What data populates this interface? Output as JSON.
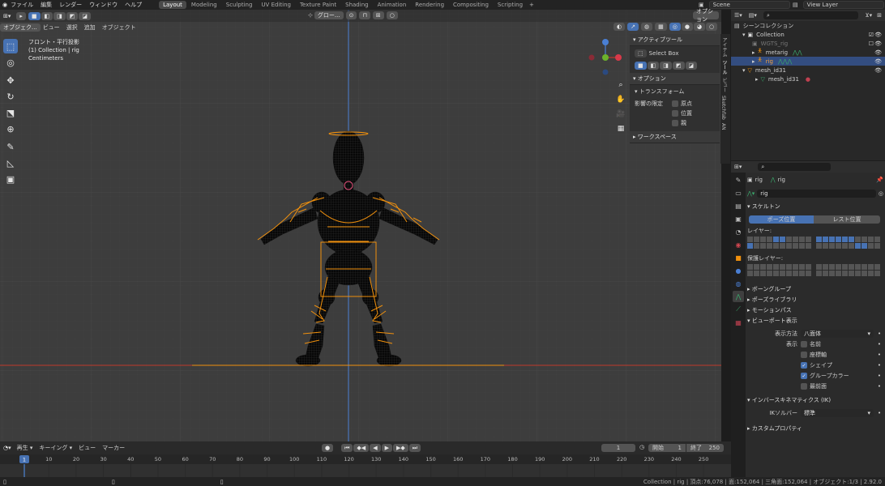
{
  "topbar": {
    "menu": [
      "ファイル",
      "編集",
      "レンダー",
      "ウィンドウ",
      "ヘルプ"
    ],
    "workspaces": [
      "Layout",
      "Modeling",
      "Sculpting",
      "UV Editing",
      "Texture Paint",
      "Shading",
      "Animation",
      "Rendering",
      "Compositing",
      "Scripting"
    ],
    "active_workspace": "Layout",
    "scene": "Scene",
    "view_layer": "View Layer"
  },
  "viewport": {
    "mode": "オブジェク...",
    "menu": [
      "ビュー",
      "選択",
      "追加",
      "オブジェクト"
    ],
    "transform_orientation": "グロー...",
    "options_label": "オプション",
    "overlay_title": "フロント・平行投影",
    "overlay_collection": "(1) Collection | rig",
    "overlay_units": "Centimeters"
  },
  "npanel": {
    "active_tool_section": "アクティブツール",
    "select_box": "Select Box",
    "options_section": "オプション",
    "transform_section": "トランスフォーム",
    "affect_only": "影響の限定",
    "checkboxes": [
      "原点",
      "位置",
      "親"
    ],
    "workspace_section": "ワークスペース",
    "tabs": [
      "アイテム",
      "ツール",
      "ビュー",
      "Sketchfab",
      "AN"
    ]
  },
  "outliner": {
    "root": "シーンコレクション",
    "items": [
      {
        "label": "Collection",
        "indent": 1
      },
      {
        "label": "WGTS_rig",
        "indent": 2
      },
      {
        "label": "metarig",
        "indent": 2
      },
      {
        "label": "rig",
        "indent": 2
      },
      {
        "label": "mesh_id31",
        "indent": 1
      },
      {
        "label": "mesh_id31",
        "indent": 2
      }
    ]
  },
  "properties": {
    "object_name": "rig",
    "armature_name": "rig",
    "data_name": "rig",
    "skeleton_section": "スケルトン",
    "pose_position": "ポーズ位置",
    "rest_position": "レスト位置",
    "layers_label": "レイヤー:",
    "protected_layers_label": "保護レイヤー:",
    "bone_groups": "ボーングループ",
    "pose_library": "ポーズライブラリ",
    "motion_paths": "モーションパス",
    "viewport_display": "ビューポート表示",
    "display_as_label": "表示方法",
    "display_as_value": "八面体",
    "show_label": "表示",
    "show_options": [
      {
        "label": "名前",
        "checked": false
      },
      {
        "label": "座標軸",
        "checked": false
      },
      {
        "label": "シェイプ",
        "checked": true
      },
      {
        "label": "グループカラー",
        "checked": true
      },
      {
        "label": "最前面",
        "checked": false
      }
    ],
    "ik_section": "インバースキネマティクス (IK)",
    "ik_solver_label": "IKソルバー",
    "ik_solver_value": "標準",
    "custom_props": "カスタムプロパティ"
  },
  "timeline": {
    "playback": "再生",
    "keying": "キーイング",
    "view": "ビュー",
    "marker": "マーカー",
    "current_frame": "1",
    "start_label": "開始",
    "start": "1",
    "end_label": "終了",
    "end": "250",
    "ruler": [
      "10",
      "20",
      "30",
      "40",
      "50",
      "60",
      "70",
      "80",
      "90",
      "100",
      "110",
      "120",
      "130",
      "140",
      "150",
      "160",
      "170",
      "180",
      "190",
      "200",
      "210",
      "220",
      "230",
      "240",
      "250"
    ],
    "ruler_current": "1"
  },
  "statusbar": {
    "text": "Collection | rig | 頂点:76,078 | 面:152,064 | 三角面:152,064 | オブジェクト:1/3 | 2.92.0"
  },
  "colors": {
    "accent": "#4772b3",
    "bone": "#f0900d",
    "x_axis": "#c0392b",
    "z_axis": "#4a7fd4"
  }
}
